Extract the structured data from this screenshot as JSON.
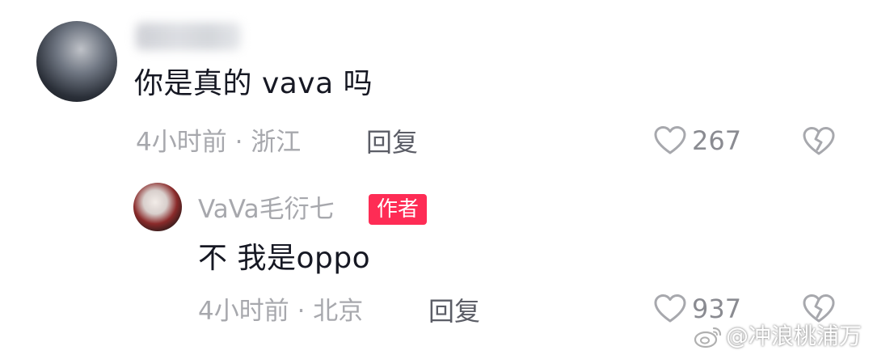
{
  "main_comment": {
    "text": "你是真的 vava 吗",
    "time_location": "4小时前 · 浙江",
    "reply_label": "回复",
    "likes": "267",
    "like_icon": "heart-outline-icon",
    "dislike_icon": "broken-heart-icon"
  },
  "reply_comment": {
    "author": "VaVa毛衍七",
    "author_badge": "作者",
    "text": "不 我是oppo",
    "time_location": "4小时前 · 北京",
    "reply_label": "回复",
    "likes": "937",
    "like_icon": "heart-outline-icon",
    "dislike_icon": "broken-heart-icon"
  },
  "watermark": {
    "text": "@冲浪桃浦万",
    "icon": "weibo-logo-icon"
  },
  "colors": {
    "badge": "#fe2c55",
    "primary_text": "#161823",
    "meta_text": "#a7a8ad",
    "reply_text": "#5b5d66"
  }
}
